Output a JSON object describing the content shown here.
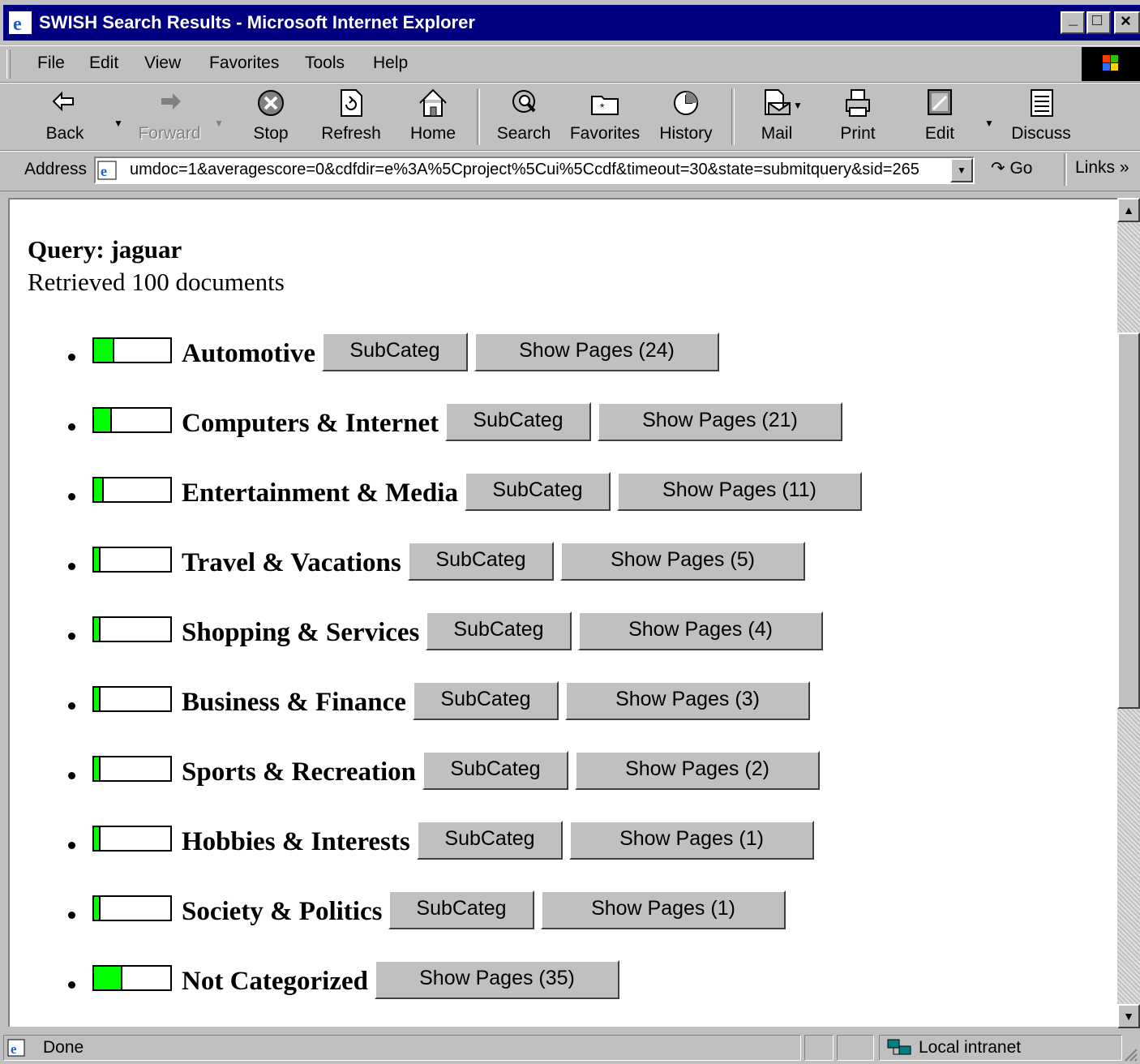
{
  "window": {
    "title": "SWISH Search Results - Microsoft Internet Explorer",
    "minimize": "_",
    "maximize": "□",
    "close": "×"
  },
  "menu": {
    "file": "File",
    "edit": "Edit",
    "view": "View",
    "favorites": "Favorites",
    "tools": "Tools",
    "help": "Help"
  },
  "toolbar": {
    "back": "Back",
    "forward": "Forward",
    "stop": "Stop",
    "refresh": "Refresh",
    "home": "Home",
    "search": "Search",
    "favorites": "Favorites",
    "history": "History",
    "mail": "Mail",
    "print": "Print",
    "edit": "Edit",
    "discuss": "Discuss"
  },
  "address": {
    "label": "Address",
    "url": "umdoc=1&averagescore=0&cdfdir=e%3A%5Cproject%5Cui%5Ccdf&timeout=30&state=submitquery&sid=265",
    "go": "Go",
    "links": "Links »"
  },
  "page": {
    "query_label": "Query: jaguar",
    "retrieved": "Retrieved 100 documents",
    "subcateg_label": "SubCateg",
    "categories": [
      {
        "name": "Automotive",
        "show_pages": "Show Pages (24)",
        "count": 24
      },
      {
        "name": "Computers & Internet",
        "show_pages": "Show Pages (21)",
        "count": 21
      },
      {
        "name": "Entertainment & Media",
        "show_pages": "Show Pages (11)",
        "count": 11
      },
      {
        "name": "Travel & Vacations",
        "show_pages": "Show Pages (5)",
        "count": 5
      },
      {
        "name": "Shopping & Services",
        "show_pages": "Show Pages (4)",
        "count": 4
      },
      {
        "name": "Business & Finance",
        "show_pages": "Show Pages (3)",
        "count": 3
      },
      {
        "name": "Sports & Recreation",
        "show_pages": "Show Pages (2)",
        "count": 2
      },
      {
        "name": "Hobbies & Interests",
        "show_pages": "Show Pages (1)",
        "count": 1
      },
      {
        "name": "Society & Politics",
        "show_pages": "Show Pages (1)",
        "count": 1
      },
      {
        "name": "Not Categorized",
        "show_pages": "Show Pages (35)",
        "count": 35
      }
    ]
  },
  "status": {
    "text": "Done",
    "zone": "Local intranet"
  },
  "colors": {
    "titlebar": "#000080",
    "bar_fill": "#00ff00",
    "chrome": "#c0c0c0"
  }
}
